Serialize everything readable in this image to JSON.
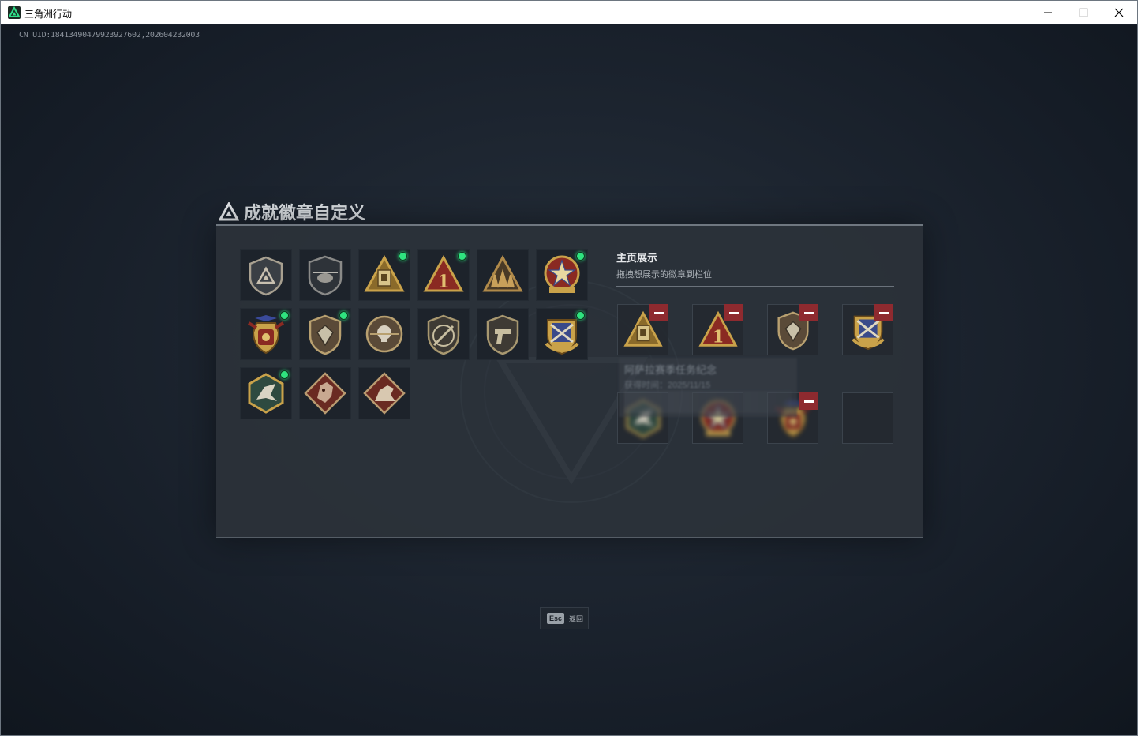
{
  "window": {
    "title": "三角洲行动",
    "controls": [
      "minimize-icon",
      "maximize-icon",
      "close-icon"
    ]
  },
  "game": {
    "uid_text": "CN UID:18413490479923927602,202604232003",
    "page_title": "成就徽章自定义",
    "badges": [
      {
        "icon": "shield-triangle-badge",
        "new": false
      },
      {
        "icon": "helicopter-badge",
        "new": false
      },
      {
        "icon": "tower-triangle-badge",
        "new": true
      },
      {
        "icon": "number-one-triangle-badge",
        "new": true
      },
      {
        "icon": "soldiers-triangle-badge",
        "new": false
      },
      {
        "icon": "star-medal-badge",
        "new": true
      },
      {
        "icon": "winged-shield-badge",
        "new": true
      },
      {
        "icon": "gem-shield-badge",
        "new": true
      },
      {
        "icon": "skull-round-badge",
        "new": false
      },
      {
        "icon": "rifle-shield-badge",
        "new": false
      },
      {
        "icon": "pistol-shield-badge",
        "new": false
      },
      {
        "icon": "crossed-rifles-badge",
        "new": true
      },
      {
        "icon": "green-hexagon-badge",
        "new": true
      },
      {
        "icon": "dragon-diamond-badge",
        "new": false
      },
      {
        "icon": "rider-diamond-badge",
        "new": false
      }
    ],
    "showcase": {
      "title": "主页展示",
      "subtitle": "拖拽想展示的徽章到栏位",
      "slots": [
        {
          "icon": "tower-triangle-badge",
          "removable": true
        },
        {
          "icon": "number-one-triangle-badge",
          "removable": true
        },
        {
          "icon": "gem-shield-badge",
          "removable": true
        },
        {
          "icon": "crossed-rifles-badge",
          "removable": true
        },
        {
          "icon": "green-hexagon-badge",
          "removable": false
        },
        {
          "icon": "star-medal-badge",
          "removable": false
        },
        {
          "icon": "winged-shield-badge",
          "removable": true
        },
        {
          "icon": "",
          "removable": false
        }
      ]
    },
    "tooltip": {
      "title": "阿萨拉赛季任务纪念",
      "date": "获得时间：2025/11/15"
    },
    "esc": {
      "key": "Esc",
      "label": "返回"
    }
  },
  "colors": {
    "accent_green": "#2fe37f",
    "remove_red": "#8e2a2f",
    "badge_gold": "#c9a24a",
    "badge_red": "#8a2a22"
  }
}
